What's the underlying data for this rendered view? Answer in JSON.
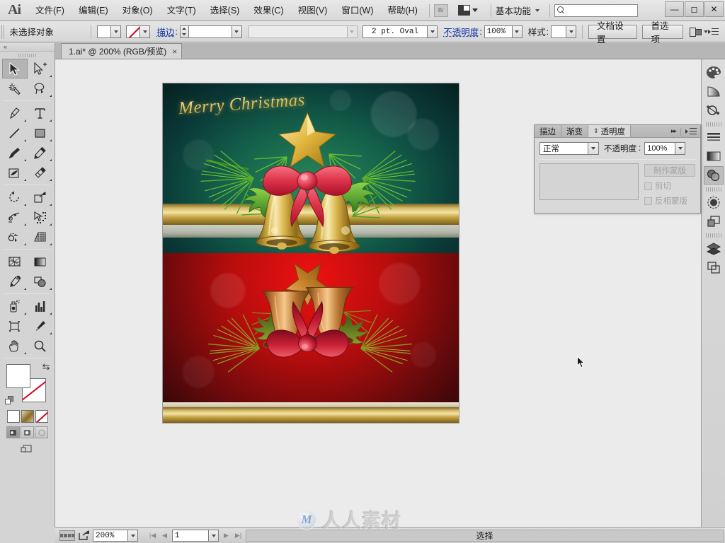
{
  "app": {
    "logo": "Ai",
    "title": "Adobe Illustrator"
  },
  "menubar": {
    "items": [
      {
        "label": "文件(F)",
        "name": "menu-file"
      },
      {
        "label": "编辑(E)",
        "name": "menu-edit"
      },
      {
        "label": "对象(O)",
        "name": "menu-object"
      },
      {
        "label": "文字(T)",
        "name": "menu-type"
      },
      {
        "label": "选择(S)",
        "name": "menu-select"
      },
      {
        "label": "效果(C)",
        "name": "menu-effect"
      },
      {
        "label": "视图(V)",
        "name": "menu-view"
      },
      {
        "label": "窗口(W)",
        "name": "menu-window"
      },
      {
        "label": "帮助(H)",
        "name": "menu-help"
      }
    ],
    "bridge_label": "Br",
    "workspace": "基本功能",
    "search_placeholder": "",
    "search_value": "",
    "window_minimize": "—",
    "window_maximize": "◻",
    "window_close": "✕"
  },
  "controlbar": {
    "selection_status": "未选择对象",
    "fill_label": "",
    "stroke_link_label": "描边",
    "stroke_weight": "",
    "profile_value": "",
    "brush_value": "2 pt. Oval",
    "opacity_label": "不透明度",
    "opacity_value": "100%",
    "style_label": "样式",
    "document_setup_btn": "文档设置",
    "preferences_btn": "首选项"
  },
  "tabbar": {
    "document_tab": "1.ai* @ 200% (RGB/预览)",
    "close_glyph": "×"
  },
  "toolbar": {
    "collapse_glyph": "«",
    "tools": [
      {
        "name": "selection-tool",
        "selected": true
      },
      {
        "name": "direct-selection-tool",
        "selected": false
      },
      {
        "name": "magic-wand-tool",
        "selected": false
      },
      {
        "name": "lasso-tool",
        "selected": false
      },
      {
        "name": "pen-tool",
        "selected": false
      },
      {
        "name": "type-tool",
        "selected": false
      },
      {
        "name": "line-segment-tool",
        "selected": false
      },
      {
        "name": "rectangle-tool",
        "selected": false
      },
      {
        "name": "paintbrush-tool",
        "selected": false
      },
      {
        "name": "pencil-tool",
        "selected": false
      },
      {
        "name": "blob-brush-tool",
        "selected": false
      },
      {
        "name": "eraser-tool",
        "selected": false
      },
      {
        "name": "rotate-tool",
        "selected": false
      },
      {
        "name": "scale-tool",
        "selected": false
      },
      {
        "name": "width-tool",
        "selected": false
      },
      {
        "name": "free-transform-tool",
        "selected": false
      },
      {
        "name": "shape-builder-tool",
        "selected": false
      },
      {
        "name": "perspective-grid-tool",
        "selected": false
      },
      {
        "name": "mesh-tool",
        "selected": false
      },
      {
        "name": "gradient-tool",
        "selected": false
      },
      {
        "name": "eyedropper-tool",
        "selected": false
      },
      {
        "name": "blend-tool",
        "selected": false
      },
      {
        "name": "symbol-sprayer-tool",
        "selected": false
      },
      {
        "name": "column-graph-tool",
        "selected": false
      },
      {
        "name": "artboard-tool",
        "selected": false
      },
      {
        "name": "slice-tool",
        "selected": false
      },
      {
        "name": "hand-tool",
        "selected": false
      },
      {
        "name": "zoom-tool",
        "selected": false
      }
    ],
    "fill_color": "#ffffff",
    "stroke_color": "none",
    "swap_glyph": "⇆",
    "mode_buttons": [
      {
        "name": "color-mode-button",
        "kind": "solid"
      },
      {
        "name": "gradient-mode-button",
        "kind": "gradient"
      },
      {
        "name": "none-mode-button",
        "kind": "none"
      }
    ],
    "screen_modes": [
      {
        "name": "normal-screen-mode-button",
        "active": true
      },
      {
        "name": "fullscreen-menubar-mode-button",
        "active": false
      },
      {
        "name": "fullscreen-mode-button",
        "active": false
      }
    ]
  },
  "canvas": {
    "artwork_title": "Merry Christmas",
    "zoom": "200%"
  },
  "transparency_panel": {
    "tabs": [
      {
        "label": "描边",
        "name": "panel-tab-stroke",
        "active": false
      },
      {
        "label": "渐变",
        "name": "panel-tab-gradient",
        "active": false
      },
      {
        "label": "透明度",
        "name": "panel-tab-transparency",
        "active": true
      }
    ],
    "blend_mode": "正常",
    "opacity_label": "不透明度",
    "opacity_value": "100%",
    "make_mask_btn": "制作蒙版",
    "clip_checkbox": "剪切",
    "invert_mask_checkbox": "反相蒙版",
    "collapse_glyph": "▸▸",
    "menu_glyph": "≡"
  },
  "dock": {
    "buttons": [
      {
        "name": "color-panel-button",
        "icon": "palette-icon",
        "selected": false
      },
      {
        "name": "color-guide-panel-button",
        "icon": "color-guide-icon",
        "selected": false
      },
      {
        "name": "symbols-panel-button",
        "icon": "symbols-icon",
        "selected": false
      },
      {
        "name": "stroke-panel-button",
        "icon": "stroke-icon",
        "selected": false
      },
      {
        "name": "gradient-panel-button",
        "icon": "gradient-icon",
        "selected": false
      },
      {
        "name": "transparency-panel-button",
        "icon": "transparency-icon",
        "selected": true
      },
      {
        "name": "appearance-panel-button",
        "icon": "appearance-icon",
        "selected": false
      },
      {
        "name": "graphic-styles-panel-button",
        "icon": "graphic-styles-icon",
        "selected": false
      },
      {
        "name": "layers-panel-button",
        "icon": "layers-icon",
        "selected": false
      },
      {
        "name": "artboards-panel-button",
        "icon": "artboards-icon",
        "selected": false
      }
    ]
  },
  "statusbar": {
    "zoom_value": "200%",
    "page_value": "1",
    "status_text": "选择",
    "first_glyph": "|◀",
    "prev_glyph": "◀",
    "next_glyph": "▶",
    "last_glyph": "▶|"
  },
  "watermark": {
    "logo_letter": "M",
    "text": "人人素材"
  },
  "colors": {
    "chrome_light": "#e6e6e6",
    "chrome_mid": "#d4d4d4",
    "chrome_dark": "#b6b6b6",
    "link_blue": "#1436a8",
    "none_red": "#d0021b",
    "canvas_bg": "#ebebeb",
    "art_green": "#14604a",
    "art_red": "#b80d0d",
    "art_gold": "#d8be6a"
  }
}
